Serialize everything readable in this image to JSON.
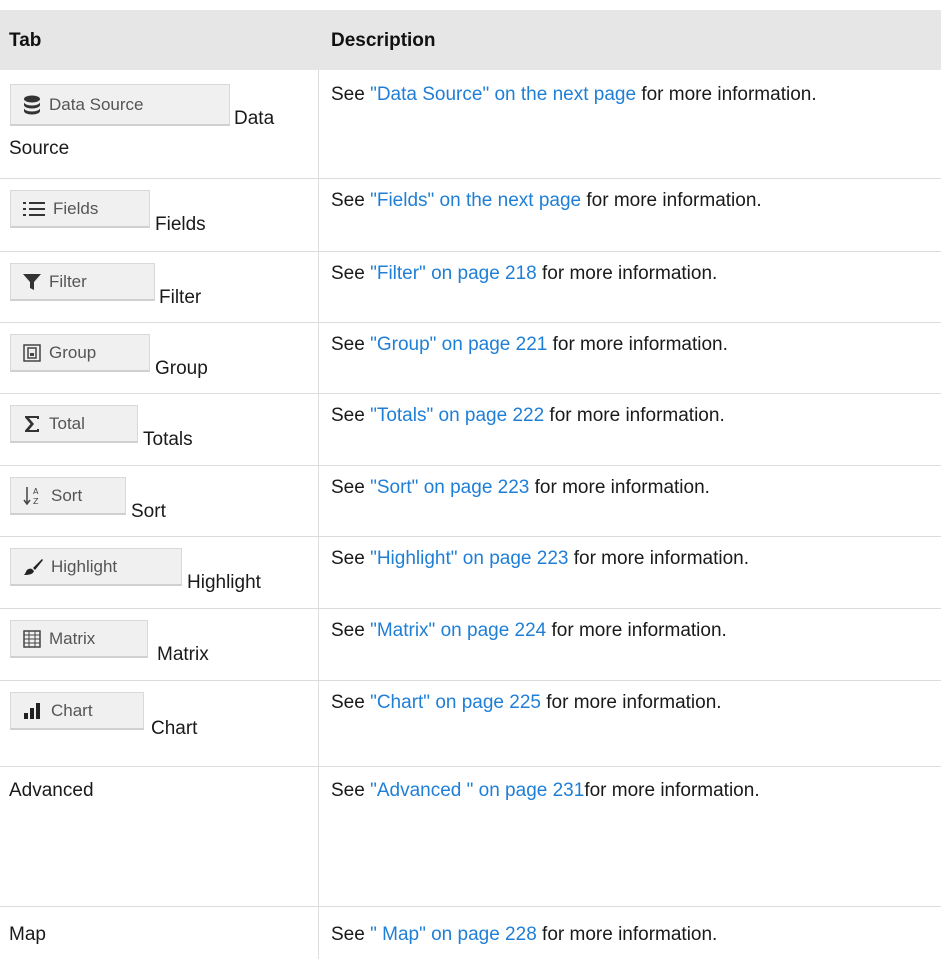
{
  "headers": {
    "tab": "Tab",
    "description": "Description"
  },
  "rows": [
    {
      "button": "Data Source",
      "icon": "database-icon",
      "label": "Data",
      "label2": "Source",
      "pre": "See ",
      "link": "\"Data Source\" on the next page",
      "post": " for more information."
    },
    {
      "button": "Fields",
      "icon": "list-icon",
      "label": "Fields",
      "pre": "See ",
      "link": "\"Fields\" on the next page",
      "post": " for more information."
    },
    {
      "button": "Filter",
      "icon": "filter-icon",
      "label": "Filter",
      "pre": "See ",
      "link": "\"Filter\" on page 218",
      "post": " for more information."
    },
    {
      "button": "Group",
      "icon": "group-icon",
      "label": "Group",
      "pre": "See ",
      "link": "\"Group\" on page 221",
      "post": " for more information."
    },
    {
      "button": "Total",
      "icon": "sigma-icon",
      "label": "Totals",
      "pre": "See ",
      "link": "\"Totals\" on page 222",
      "post": " for more information."
    },
    {
      "button": "Sort",
      "icon": "sort-az-icon",
      "label": "Sort",
      "pre": "See ",
      "link": "\"Sort\" on page 223",
      "post": " for more information."
    },
    {
      "button": "Highlight",
      "icon": "brush-icon",
      "label": "Highlight",
      "pre": "See ",
      "link": "\"Highlight\" on page 223",
      "post": " for more information."
    },
    {
      "button": "Matrix",
      "icon": "matrix-icon",
      "label": "Matrix",
      "pre": "See ",
      "link": "\"Matrix\" on page 224",
      "post": " for more information."
    },
    {
      "button": "Chart",
      "icon": "bar-chart-icon",
      "label": "Chart",
      "pre": "See ",
      "link": "\"Chart\" on page 225",
      "post": " for more information."
    },
    {
      "label": "Advanced",
      "pre": "See ",
      "link": "\"Advanced \" on page 231",
      "post": "for more information."
    },
    {
      "label": "Map",
      "pre": "See ",
      "link": "\" Map\" on page 228",
      "post": " for more information."
    }
  ],
  "colors": {
    "link": "#1f7fd6",
    "header_bg": "#e6e6e6",
    "button_bg": "#f0f0f0"
  }
}
